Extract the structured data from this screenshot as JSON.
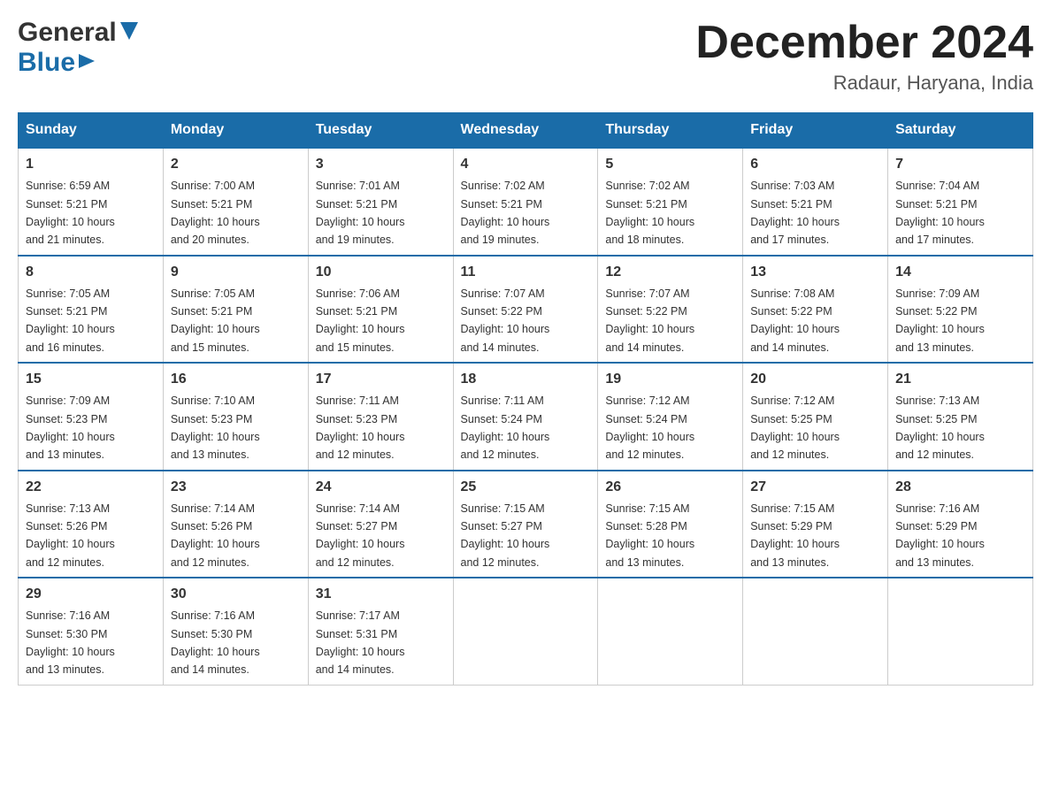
{
  "header": {
    "logo_general": "General",
    "logo_blue": "Blue",
    "month_title": "December 2024",
    "location": "Radaur, Haryana, India"
  },
  "weekdays": [
    "Sunday",
    "Monday",
    "Tuesday",
    "Wednesday",
    "Thursday",
    "Friday",
    "Saturday"
  ],
  "weeks": [
    [
      {
        "day": "1",
        "sunrise": "6:59 AM",
        "sunset": "5:21 PM",
        "daylight": "10 hours and 21 minutes."
      },
      {
        "day": "2",
        "sunrise": "7:00 AM",
        "sunset": "5:21 PM",
        "daylight": "10 hours and 20 minutes."
      },
      {
        "day": "3",
        "sunrise": "7:01 AM",
        "sunset": "5:21 PM",
        "daylight": "10 hours and 19 minutes."
      },
      {
        "day": "4",
        "sunrise": "7:02 AM",
        "sunset": "5:21 PM",
        "daylight": "10 hours and 19 minutes."
      },
      {
        "day": "5",
        "sunrise": "7:02 AM",
        "sunset": "5:21 PM",
        "daylight": "10 hours and 18 minutes."
      },
      {
        "day": "6",
        "sunrise": "7:03 AM",
        "sunset": "5:21 PM",
        "daylight": "10 hours and 17 minutes."
      },
      {
        "day": "7",
        "sunrise": "7:04 AM",
        "sunset": "5:21 PM",
        "daylight": "10 hours and 17 minutes."
      }
    ],
    [
      {
        "day": "8",
        "sunrise": "7:05 AM",
        "sunset": "5:21 PM",
        "daylight": "10 hours and 16 minutes."
      },
      {
        "day": "9",
        "sunrise": "7:05 AM",
        "sunset": "5:21 PM",
        "daylight": "10 hours and 15 minutes."
      },
      {
        "day": "10",
        "sunrise": "7:06 AM",
        "sunset": "5:21 PM",
        "daylight": "10 hours and 15 minutes."
      },
      {
        "day": "11",
        "sunrise": "7:07 AM",
        "sunset": "5:22 PM",
        "daylight": "10 hours and 14 minutes."
      },
      {
        "day": "12",
        "sunrise": "7:07 AM",
        "sunset": "5:22 PM",
        "daylight": "10 hours and 14 minutes."
      },
      {
        "day": "13",
        "sunrise": "7:08 AM",
        "sunset": "5:22 PM",
        "daylight": "10 hours and 14 minutes."
      },
      {
        "day": "14",
        "sunrise": "7:09 AM",
        "sunset": "5:22 PM",
        "daylight": "10 hours and 13 minutes."
      }
    ],
    [
      {
        "day": "15",
        "sunrise": "7:09 AM",
        "sunset": "5:23 PM",
        "daylight": "10 hours and 13 minutes."
      },
      {
        "day": "16",
        "sunrise": "7:10 AM",
        "sunset": "5:23 PM",
        "daylight": "10 hours and 13 minutes."
      },
      {
        "day": "17",
        "sunrise": "7:11 AM",
        "sunset": "5:23 PM",
        "daylight": "10 hours and 12 minutes."
      },
      {
        "day": "18",
        "sunrise": "7:11 AM",
        "sunset": "5:24 PM",
        "daylight": "10 hours and 12 minutes."
      },
      {
        "day": "19",
        "sunrise": "7:12 AM",
        "sunset": "5:24 PM",
        "daylight": "10 hours and 12 minutes."
      },
      {
        "day": "20",
        "sunrise": "7:12 AM",
        "sunset": "5:25 PM",
        "daylight": "10 hours and 12 minutes."
      },
      {
        "day": "21",
        "sunrise": "7:13 AM",
        "sunset": "5:25 PM",
        "daylight": "10 hours and 12 minutes."
      }
    ],
    [
      {
        "day": "22",
        "sunrise": "7:13 AM",
        "sunset": "5:26 PM",
        "daylight": "10 hours and 12 minutes."
      },
      {
        "day": "23",
        "sunrise": "7:14 AM",
        "sunset": "5:26 PM",
        "daylight": "10 hours and 12 minutes."
      },
      {
        "day": "24",
        "sunrise": "7:14 AM",
        "sunset": "5:27 PM",
        "daylight": "10 hours and 12 minutes."
      },
      {
        "day": "25",
        "sunrise": "7:15 AM",
        "sunset": "5:27 PM",
        "daylight": "10 hours and 12 minutes."
      },
      {
        "day": "26",
        "sunrise": "7:15 AM",
        "sunset": "5:28 PM",
        "daylight": "10 hours and 13 minutes."
      },
      {
        "day": "27",
        "sunrise": "7:15 AM",
        "sunset": "5:29 PM",
        "daylight": "10 hours and 13 minutes."
      },
      {
        "day": "28",
        "sunrise": "7:16 AM",
        "sunset": "5:29 PM",
        "daylight": "10 hours and 13 minutes."
      }
    ],
    [
      {
        "day": "29",
        "sunrise": "7:16 AM",
        "sunset": "5:30 PM",
        "daylight": "10 hours and 13 minutes."
      },
      {
        "day": "30",
        "sunrise": "7:16 AM",
        "sunset": "5:30 PM",
        "daylight": "10 hours and 14 minutes."
      },
      {
        "day": "31",
        "sunrise": "7:17 AM",
        "sunset": "5:31 PM",
        "daylight": "10 hours and 14 minutes."
      },
      null,
      null,
      null,
      null
    ]
  ],
  "labels": {
    "sunrise": "Sunrise:",
    "sunset": "Sunset:",
    "daylight": "Daylight:"
  }
}
